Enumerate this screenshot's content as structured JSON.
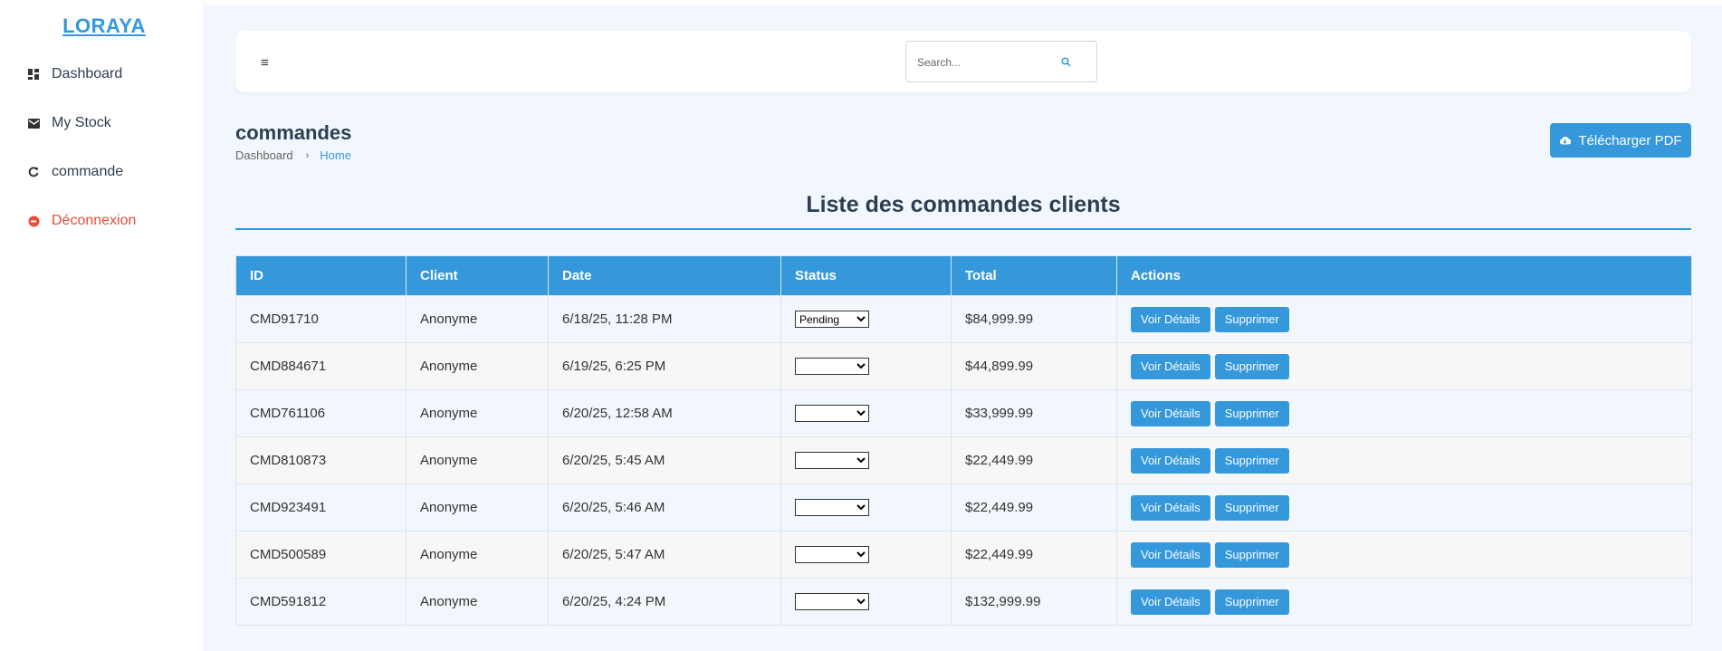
{
  "app": {
    "logo": "LORAYA"
  },
  "sidebar": {
    "items": [
      {
        "label": "Dashboard",
        "icon": "dashboard-icon"
      },
      {
        "label": "My Stock",
        "icon": "stock-icon"
      },
      {
        "label": "commande",
        "icon": "refresh-icon"
      },
      {
        "label": "Déconnexion",
        "icon": "logout-icon"
      }
    ]
  },
  "header": {
    "menu_icon": "hamburger-icon",
    "search_placeholder": "Search...",
    "search_icon": "search-icon"
  },
  "page": {
    "title": "commandes",
    "breadcrumb": [
      "Dashboard",
      "Home"
    ],
    "pdf_button": "Télécharger PDF",
    "list_title": "Liste des commandes clients"
  },
  "table": {
    "columns": [
      "ID",
      "Client",
      "Date",
      "Status",
      "Total",
      "Actions"
    ],
    "rows": [
      {
        "id": "CMD91710",
        "client": "Anonyme",
        "date": "6/18/25, 11:28 PM",
        "status": "Pending",
        "total": "$84,999.99"
      },
      {
        "id": "CMD884671",
        "client": "Anonyme",
        "date": "6/19/25, 6:25 PM",
        "status": "",
        "total": "$44,899.99"
      },
      {
        "id": "CMD761106",
        "client": "Anonyme",
        "date": "6/20/25, 12:58 AM",
        "status": "",
        "total": "$33,999.99"
      },
      {
        "id": "CMD810873",
        "client": "Anonyme",
        "date": "6/20/25, 5:45 AM",
        "status": "",
        "total": "$22,449.99"
      },
      {
        "id": "CMD923491",
        "client": "Anonyme",
        "date": "6/20/25, 5:46 AM",
        "status": "",
        "total": "$22,449.99"
      },
      {
        "id": "CMD500589",
        "client": "Anonyme",
        "date": "6/20/25, 5:47 AM",
        "status": "",
        "total": "$22,449.99"
      },
      {
        "id": "CMD591812",
        "client": "Anonyme",
        "date": "6/20/25, 4:24 PM",
        "status": "",
        "total": "$132,999.99"
      }
    ],
    "details_button": "Voir Détails",
    "delete_button": "Supprimer"
  },
  "colors": {
    "accent": "#3498db",
    "danger": "#e74c3c",
    "text": "#2c3e50",
    "background": "#f1f7fc"
  }
}
